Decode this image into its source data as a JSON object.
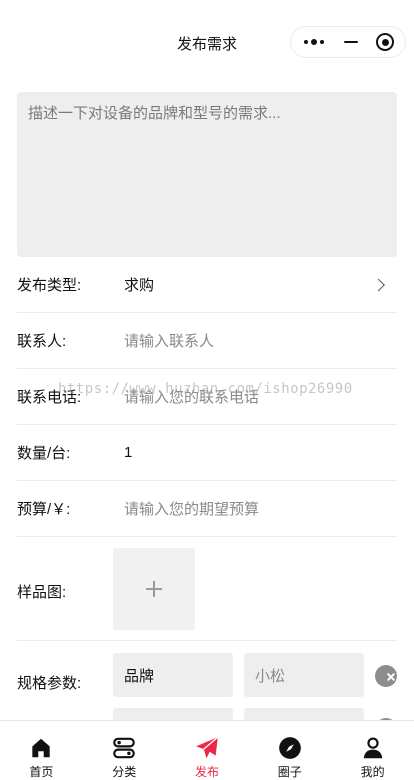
{
  "header": {
    "title": "发布需求"
  },
  "description": {
    "placeholder": "描述一下对设备的品牌和型号的需求..."
  },
  "form": {
    "type": {
      "label": "发布类型:",
      "value": "求购"
    },
    "contact": {
      "label": "联系人:",
      "placeholder": "请输入联系人"
    },
    "phone": {
      "label": "联系电话:",
      "placeholder": "请输入您的联系电话"
    },
    "quantity": {
      "label": "数量/台:",
      "value": "1"
    },
    "budget": {
      "label": "预算/￥:",
      "placeholder": "请输入您的期望预算"
    },
    "sample": {
      "label": "样品图:"
    },
    "specs": {
      "label": "规格参数:",
      "rows": [
        {
          "key": "品牌",
          "value": "小松"
        }
      ]
    }
  },
  "watermark": "https://www.huzhan.com/ishop26990",
  "tabbar": {
    "active_color": "#ee2747",
    "items": [
      {
        "label": "首页",
        "icon": "home-icon"
      },
      {
        "label": "分类",
        "icon": "category-icon"
      },
      {
        "label": "发布",
        "icon": "paper-plane-icon"
      },
      {
        "label": "圈子",
        "icon": "compass-icon"
      },
      {
        "label": "我的",
        "icon": "user-icon"
      }
    ]
  }
}
